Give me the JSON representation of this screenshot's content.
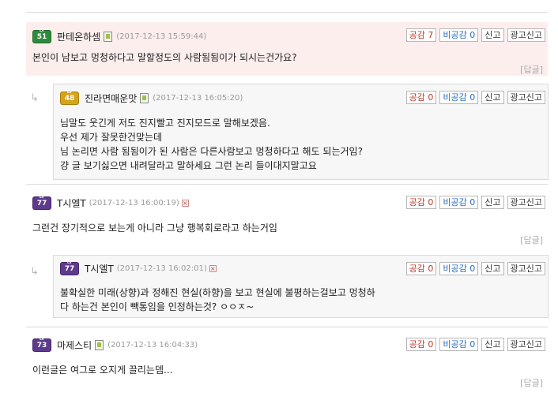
{
  "action_labels": {
    "like": "공감",
    "dislike": "비공감",
    "report": "신고",
    "ad_report": "광고신고"
  },
  "reply_label": "[답글]",
  "reply_arrow": "↳",
  "comments": [
    {
      "level": "51",
      "level_color": "green",
      "nickname": "판테온하셈",
      "icon": "mobile-icon",
      "date": "(2017-12-13 15:59:44)",
      "likes": "7",
      "dislikes": "0",
      "lines": [
        "본인이 남보고 멍청하다고 말할정도의 사람됨됨이가 되시는건가요?"
      ]
    },
    {
      "level": "48",
      "level_color": "gold",
      "nickname": "진라면매운맛",
      "icon": "mobile-icon",
      "date": "(2017-12-13 16:05:20)",
      "likes": "0",
      "dislikes": "0",
      "lines": [
        "님말도 웃긴게 저도 진지빨고 진지모드로 말해보겠음.",
        "우선 제가 잘못한건맞는데",
        "님 논리면 사람 됨됨이가 된 사람은 다른사람보고 멍청하다고 해도 되는거임?",
        "걍 글 보기싫으면 내려달라고 말하세요 그런 논리 들이대지말고요"
      ]
    },
    {
      "level": "77",
      "level_color": "purple",
      "nickname": "T시엘T",
      "icon": "x-icon",
      "date": "(2017-12-13 16:00:19)",
      "likes": "0",
      "dislikes": "0",
      "lines": [
        "그런건 장기적으로 보는게 아니라 그냥 행복회로라고 하는거임"
      ]
    },
    {
      "level": "77",
      "level_color": "purple",
      "nickname": "T시엘T",
      "icon": "x-icon",
      "date": "(2017-12-13 16:02:01)",
      "likes": "0",
      "dislikes": "0",
      "lines": [
        "불확실한 미래(상향)과 정해진 현실(하향)을 보고 현실에 불평하는걸보고 멍청하",
        "다 하는건 본인이 빽통임을 인정하는것? ㅇㅇㅈ~"
      ]
    },
    {
      "level": "73",
      "level_color": "purple",
      "nickname": "마제스티",
      "icon": "mobile-icon",
      "date": "(2017-12-13 16:04:33)",
      "likes": "0",
      "dislikes": "0",
      "lines": [
        "이런글은 여그로 오지게 끌리는뎀..."
      ]
    }
  ]
}
